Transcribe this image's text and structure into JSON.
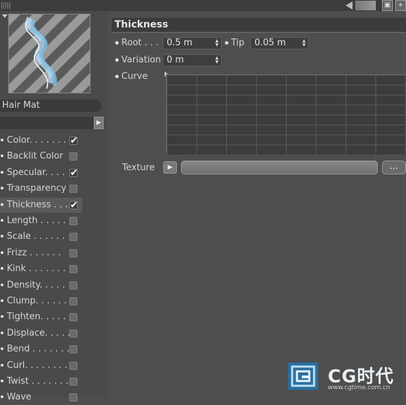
{
  "material": {
    "name": "Hair Mat",
    "channels": [
      {
        "label": "Color. . . . . . .",
        "checked": true
      },
      {
        "label": "Backlit Color",
        "checked": false
      },
      {
        "label": "Specular. . . .",
        "checked": true
      },
      {
        "label": "Transparency",
        "checked": false
      },
      {
        "label": "Thickness . . .",
        "checked": true,
        "active": true
      },
      {
        "label": "Length . . . . .",
        "checked": false
      },
      {
        "label": "Scale . . . . . .",
        "checked": false
      },
      {
        "label": "Frizz . . . . . .",
        "checked": false
      },
      {
        "label": "Kink . . . . . . .",
        "checked": false
      },
      {
        "label": "Density. . . . .",
        "checked": false
      },
      {
        "label": "Clump. . . . . .",
        "checked": false
      },
      {
        "label": "Tighten. . . . .",
        "checked": false
      },
      {
        "label": "Displace. . . . .",
        "checked": false
      },
      {
        "label": "Bend . . . . . . .",
        "checked": false
      },
      {
        "label": "Curl. . . . . . . .",
        "checked": false
      },
      {
        "label": "Twist . . . . . . .",
        "checked": false
      },
      {
        "label": "Wave",
        "checked": false
      }
    ]
  },
  "panel": {
    "title": "Thickness",
    "root_label": "Root . . .",
    "root_value": "0.5 m",
    "tip_label": "Tip",
    "tip_value": "0.05 m",
    "variation_label": "Variation",
    "variation_value": "0 m",
    "curve_label": "Curve",
    "texture_label": "Texture",
    "texture_more": "..."
  },
  "watermark": {
    "brand": "CG时代",
    "url": "www.cgtime.com.cn"
  },
  "colors": {
    "background": "#4e4e4e",
    "field": "#3e3e3e",
    "header": "#3b3b3b",
    "logo_blue": "#2a6f9e"
  }
}
